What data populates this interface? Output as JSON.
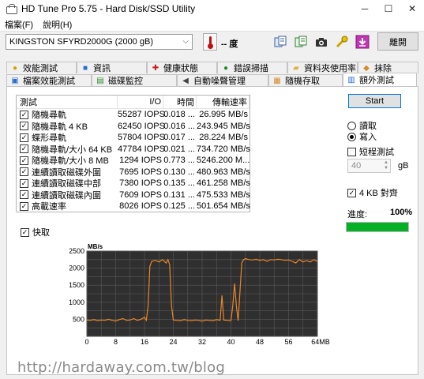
{
  "window": {
    "title": "HD Tune Pro 5.75 - Hard Disk/SSD Utility",
    "minimize": "─",
    "maximize": "☐",
    "close": "✕"
  },
  "menu": [
    "檔案(F)",
    "說明(H)"
  ],
  "toolbar": {
    "drive": "KINGSTON SFYRD2000G (2000 gB)",
    "temperature": "-- 度",
    "exit_label": "離開"
  },
  "tabs_back": [
    "效能測試",
    "資訊",
    "健康狀態",
    "錯誤掃描",
    "資料夾使用率",
    "抹除"
  ],
  "tabs_front": [
    "檔案效能測試",
    "磁碟監控",
    "自動噪聲管理",
    "隨機存取",
    "額外測試"
  ],
  "table": {
    "headers": [
      "測試",
      "I/O",
      "時間",
      "傳輸速率"
    ],
    "rows": [
      {
        "name": "隨機尋軌",
        "io": "55287 IOPS",
        "time": "0.018 ...",
        "rate": "26.995 MB/s"
      },
      {
        "name": "隨機尋軌 4 KB",
        "io": "62450 IOPS",
        "time": "0.016 ...",
        "rate": "243.945 MB/s"
      },
      {
        "name": "蝶形尋軌",
        "io": "57804 IOPS",
        "time": "0.017 ...",
        "rate": "28.224 MB/s"
      },
      {
        "name": "隨機尋軌/大小 64 KB",
        "io": "47784 IOPS",
        "time": "0.021 ...",
        "rate": "734.720 MB/s"
      },
      {
        "name": "隨機尋軌/大小 8 MB",
        "io": "1294 IOPS",
        "time": "0.773 ...",
        "rate": "5246.200 M..."
      },
      {
        "name": "連續讀取磁碟外圍",
        "io": "7695 IOPS",
        "time": "0.130 ...",
        "rate": "480.963 MB/s"
      },
      {
        "name": "連續讀取磁碟中部",
        "io": "7380 IOPS",
        "time": "0.135 ...",
        "rate": "461.258 MB/s"
      },
      {
        "name": "連續讀取磁碟內圍",
        "io": "7609 IOPS",
        "time": "0.131 ...",
        "rate": "475.533 MB/s"
      },
      {
        "name": "高載速率",
        "io": "8026 IOPS",
        "time": "0.125 ...",
        "rate": "501.654 MB/s"
      }
    ]
  },
  "quick_label": "快取",
  "controls": {
    "start_label": "Start",
    "read_label": "讀取",
    "write_label": "寫入",
    "short_test_label": "短程測試",
    "short_test_value": "40",
    "gb_label": "gB",
    "align_label": "4 KB 對齊",
    "progress_label": "進度:",
    "progress_text": "100%",
    "progress_value": 1.0
  },
  "chart_data": {
    "type": "line",
    "ylabel": "MB/s",
    "xlabel": "",
    "x_unit": "MB",
    "xlim": [
      0,
      64
    ],
    "ylim": [
      0,
      2500
    ],
    "x_ticks": [
      0,
      8,
      16,
      24,
      32,
      40,
      48,
      56,
      64
    ],
    "y_ticks": [
      500,
      1000,
      1500,
      2000,
      2500
    ],
    "grid": true,
    "series": [
      {
        "color": "#e8862a",
        "points": [
          [
            0,
            480
          ],
          [
            1,
            470
          ],
          [
            2,
            490
          ],
          [
            3,
            460
          ],
          [
            4,
            480
          ],
          [
            5,
            470
          ],
          [
            6,
            500
          ],
          [
            7,
            470
          ],
          [
            8,
            450
          ],
          [
            9,
            490
          ],
          [
            10,
            520
          ],
          [
            11,
            470
          ],
          [
            12,
            480
          ],
          [
            13,
            520
          ],
          [
            14,
            470
          ],
          [
            15,
            500
          ],
          [
            16,
            560
          ],
          [
            16.5,
            470
          ],
          [
            17,
            900
          ],
          [
            17.5,
            2050
          ],
          [
            18,
            2200
          ],
          [
            19,
            2230
          ],
          [
            20,
            2180
          ],
          [
            21,
            2250
          ],
          [
            22,
            2150
          ],
          [
            22.5,
            2250
          ],
          [
            23,
            2100
          ],
          [
            23.5,
            900
          ],
          [
            24,
            480
          ],
          [
            25,
            470
          ],
          [
            26,
            460
          ],
          [
            27,
            490
          ],
          [
            28,
            470
          ],
          [
            29,
            460
          ],
          [
            30,
            480
          ],
          [
            31,
            470
          ],
          [
            32,
            450
          ],
          [
            33,
            480
          ],
          [
            34,
            470
          ],
          [
            35,
            460
          ],
          [
            36,
            490
          ],
          [
            37,
            470
          ],
          [
            37.5,
            1200
          ],
          [
            38,
            480
          ],
          [
            39,
            470
          ],
          [
            40,
            460
          ],
          [
            40.5,
            900
          ],
          [
            41,
            1550
          ],
          [
            41.5,
            900
          ],
          [
            42,
            460
          ],
          [
            42.5,
            1300
          ],
          [
            43,
            2150
          ],
          [
            43.5,
            2250
          ],
          [
            44,
            2280
          ],
          [
            45,
            2250
          ],
          [
            46,
            2240
          ],
          [
            47,
            2260
          ],
          [
            48,
            2230
          ],
          [
            49,
            2250
          ],
          [
            50,
            2200
          ],
          [
            51,
            2250
          ],
          [
            52,
            2240
          ],
          [
            53,
            2260
          ],
          [
            54,
            2250
          ],
          [
            55,
            2230
          ],
          [
            56,
            2240
          ],
          [
            57,
            2200
          ],
          [
            58,
            2150
          ],
          [
            59,
            2250
          ],
          [
            60,
            2180
          ],
          [
            61,
            2220
          ],
          [
            62,
            2180
          ],
          [
            63,
            2250
          ],
          [
            64,
            2200
          ]
        ]
      }
    ]
  },
  "watermark": "http://hardaway.com.tw/blog"
}
